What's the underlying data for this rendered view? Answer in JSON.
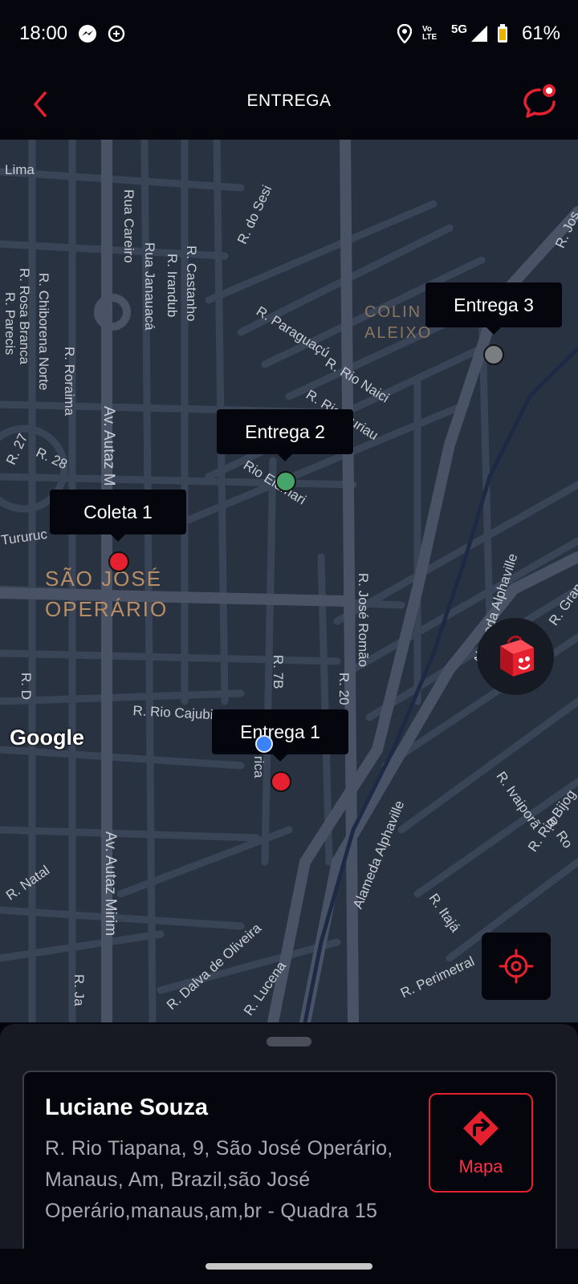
{
  "status_bar": {
    "time": "18:00",
    "network_label": "5G",
    "volte_label": "Vo LTE",
    "battery": "61%"
  },
  "app_bar": {
    "title": "ENTREGA"
  },
  "map": {
    "streets": [
      "Lima",
      "R. do Sesi",
      "Rua Careiro",
      "Rua Janauacá",
      "R. Irandub",
      "R. Castanho",
      "R. Chiborena Norte",
      "R. Rosa Branca",
      "R. Parecis",
      "R. Roraima",
      "R. 28",
      "R. 27",
      "Av. Autaz M",
      "R. Paraguaçú",
      "R. Rio Naici",
      "R. Rio Curiau",
      "Rio Eldmari",
      "R. José Romão",
      "Alameda Alphaville",
      "R. 7B",
      "R. 20",
      "R. Rio Cajubim",
      "R. D",
      "Tururuc",
      "Av. Autaz Mirim",
      "R. Natal",
      "R. Dalva de Oliveira",
      "R. Lucena",
      "Alameda Alphaville",
      "R. Itajá",
      "R. Perimetral",
      "R. Ivaiporã",
      "R. Rio Bijog",
      "R. Gran",
      "R. Jos",
      "R. Ja",
      "R. Roraima",
      "rica",
      "R. Ro"
    ],
    "districts": {
      "sao_jose": "SÃO JOSÉ\nOPERÁRIO",
      "colina": "COLIN\nALEIXO"
    },
    "attribution": "Google",
    "markers": [
      {
        "label": "Entrega 3",
        "status_color": "#7a7d82"
      },
      {
        "label": "Entrega 2",
        "status_color": "#47a56b"
      },
      {
        "label": "Coleta 1",
        "status_color": "#e5212f"
      },
      {
        "label": "Entrega 1",
        "status_color": "#e5212f"
      }
    ],
    "icons": {
      "bag": "delivery-bag-icon",
      "locate": "crosshair-icon"
    }
  },
  "delivery_card": {
    "name": "Luciane Souza",
    "address": "R. Rio Tiapana, 9, São José Operário, Manaus, Am, Brazil,são José Operário,manaus,am,br - Quadra 15",
    "map_button_label": "Mapa"
  },
  "colors": {
    "accent": "#e5212f",
    "background": "#05060d",
    "map_background": "#293241"
  }
}
